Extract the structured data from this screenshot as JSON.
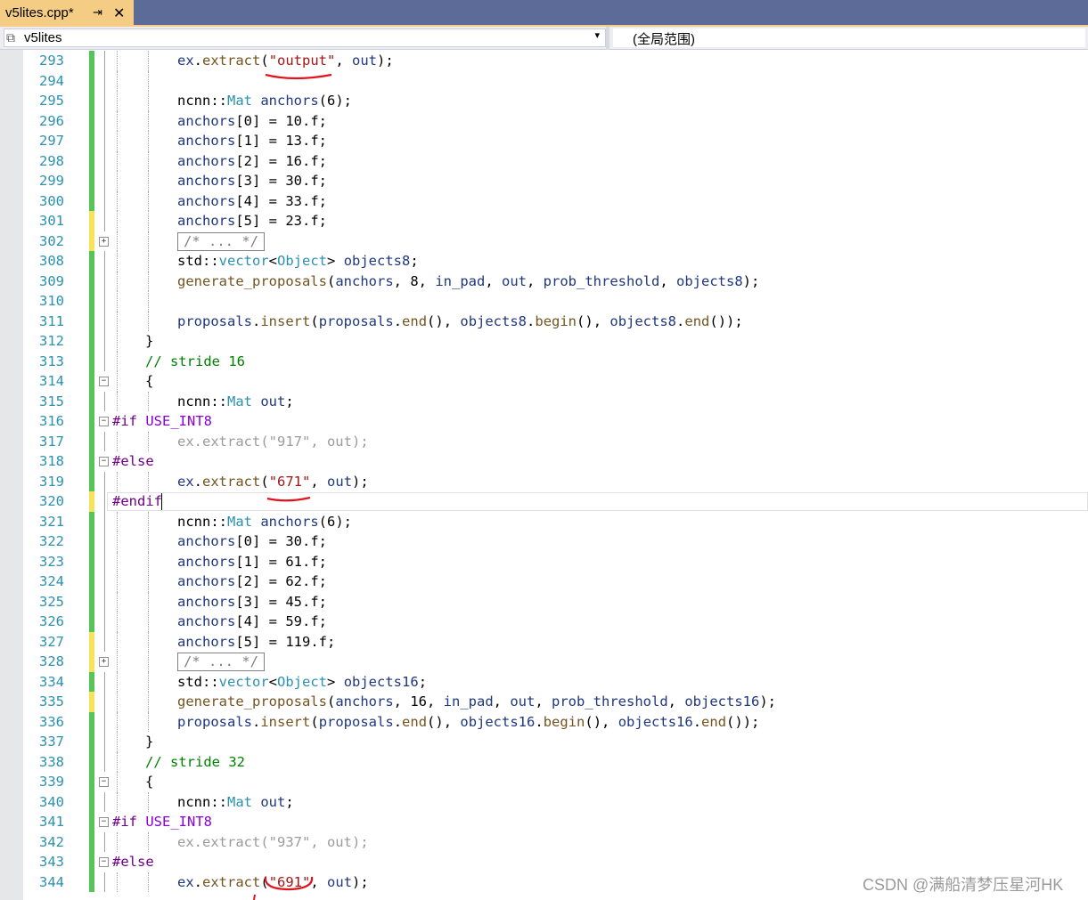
{
  "tab": {
    "title": "v5lites.cpp*",
    "pin_icon": "pin-icon",
    "close_icon": "close-icon"
  },
  "nav": {
    "project": "v5lites",
    "scope": "(全局范围)"
  },
  "watermark": "CSDN @满船清梦压星河HK",
  "colors": {
    "tab_bg": "#f5cc84",
    "tabbar_bg": "#5d6b99",
    "line_number": "#2b91af",
    "changed_saved": "#57c45a",
    "changed_unsaved": "#f5e35c"
  },
  "lines": [
    {
      "n": "293",
      "chg": "g",
      "indent": 2,
      "tokens": [
        [
          "id",
          "ex"
        ],
        [
          "",
          "."
        ],
        [
          "fn",
          "extract"
        ],
        [
          "",
          "("
        ],
        [
          "str",
          "\"output\""
        ],
        [
          "",
          ", "
        ],
        [
          "id",
          "out"
        ],
        [
          "",
          ");"
        ]
      ]
    },
    {
      "n": "294",
      "chg": "g",
      "indent": 0,
      "tokens": []
    },
    {
      "n": "295",
      "chg": "g",
      "indent": 2,
      "tokens": [
        [
          "",
          "ncnn::"
        ],
        [
          "ty",
          "Mat"
        ],
        [
          "",
          ""
        ],
        [
          "id",
          " anchors"
        ],
        [
          "",
          "("
        ],
        [
          "num",
          "6"
        ],
        [
          "",
          ");"
        ]
      ]
    },
    {
      "n": "296",
      "chg": "g",
      "indent": 2,
      "tokens": [
        [
          "id",
          "anchors"
        ],
        [
          "",
          "[0] = 10.f;"
        ]
      ]
    },
    {
      "n": "297",
      "chg": "g",
      "indent": 2,
      "tokens": [
        [
          "id",
          "anchors"
        ],
        [
          "",
          "[1] = 13.f;"
        ]
      ]
    },
    {
      "n": "298",
      "chg": "g",
      "indent": 2,
      "tokens": [
        [
          "id",
          "anchors"
        ],
        [
          "",
          "[2] = 16.f;"
        ]
      ]
    },
    {
      "n": "299",
      "chg": "g",
      "indent": 2,
      "tokens": [
        [
          "id",
          "anchors"
        ],
        [
          "",
          "[3] = 30.f;"
        ]
      ]
    },
    {
      "n": "300",
      "chg": "g",
      "indent": 2,
      "tokens": [
        [
          "id",
          "anchors"
        ],
        [
          "",
          "[4] = 33.f;"
        ]
      ]
    },
    {
      "n": "301",
      "chg": "y",
      "indent": 2,
      "tokens": [
        [
          "id",
          "anchors"
        ],
        [
          "",
          "[5] = 23.f;"
        ]
      ]
    },
    {
      "n": "302",
      "chg": "y",
      "indent": 2,
      "fold": "+",
      "collapsed": "/* ... */",
      "tokens": []
    },
    {
      "n": "308",
      "chg": "g",
      "indent": 2,
      "tokens": [
        [
          "",
          "std::"
        ],
        [
          "ty",
          "vector"
        ],
        [
          "",
          "<"
        ],
        [
          "ty",
          "Object"
        ],
        [
          "",
          "> "
        ],
        [
          "id",
          "objects8"
        ],
        [
          "",
          ";"
        ]
      ]
    },
    {
      "n": "309",
      "chg": "g",
      "indent": 2,
      "tokens": [
        [
          "fn",
          "generate_proposals"
        ],
        [
          "",
          "("
        ],
        [
          "id",
          "anchors"
        ],
        [
          "",
          ", 8, "
        ],
        [
          "id",
          "in_pad"
        ],
        [
          "",
          ", "
        ],
        [
          "id",
          "out"
        ],
        [
          "",
          ", "
        ],
        [
          "id",
          "prob_threshold"
        ],
        [
          "",
          ", "
        ],
        [
          "id",
          "objects8"
        ],
        [
          "",
          ");"
        ]
      ]
    },
    {
      "n": "310",
      "chg": "g",
      "indent": 0,
      "tokens": []
    },
    {
      "n": "311",
      "chg": "g",
      "indent": 2,
      "tokens": [
        [
          "id",
          "proposals"
        ],
        [
          "",
          "."
        ],
        [
          "fn",
          "insert"
        ],
        [
          "",
          "("
        ],
        [
          "id",
          "proposals"
        ],
        [
          "",
          "."
        ],
        [
          "fn",
          "end"
        ],
        [
          "",
          "(), "
        ],
        [
          "id",
          "objects8"
        ],
        [
          "",
          "."
        ],
        [
          "fn",
          "begin"
        ],
        [
          "",
          "(), "
        ],
        [
          "id",
          "objects8"
        ],
        [
          "",
          "."
        ],
        [
          "fn",
          "end"
        ],
        [
          "",
          "());"
        ]
      ]
    },
    {
      "n": "312",
      "chg": "g",
      "indent": 1,
      "tokens": [
        [
          "",
          "}"
        ]
      ]
    },
    {
      "n": "313",
      "chg": "g",
      "indent": 1,
      "tokens": [
        [
          "cm",
          "// stride 16"
        ]
      ]
    },
    {
      "n": "314",
      "chg": "g",
      "indent": 1,
      "fold": "-",
      "tokens": [
        [
          "",
          "{"
        ]
      ]
    },
    {
      "n": "315",
      "chg": "g",
      "indent": 2,
      "tokens": [
        [
          "",
          "ncnn::"
        ],
        [
          "ty",
          "Mat"
        ],
        [
          "id",
          " out"
        ],
        [
          "",
          ";"
        ]
      ]
    },
    {
      "n": "316",
      "chg": "g",
      "indent": 0,
      "fold": "-",
      "tokens": [
        [
          "",
          "#if "
        ],
        [
          "mac",
          "USE_INT8"
        ]
      ]
    },
    {
      "n": "317",
      "chg": "g",
      "indent": 2,
      "tokens": [
        [
          "inact",
          "ex.extract(\"917\", out);"
        ]
      ]
    },
    {
      "n": "318",
      "chg": "g",
      "indent": 0,
      "fold": "-",
      "tokens": [
        [
          "",
          "#else"
        ]
      ]
    },
    {
      "n": "319",
      "chg": "g",
      "indent": 2,
      "tokens": [
        [
          "id",
          "ex"
        ],
        [
          "",
          "."
        ],
        [
          "fn",
          "extract"
        ],
        [
          "",
          "("
        ],
        [
          "str",
          "\"671\""
        ],
        [
          "",
          ", "
        ],
        [
          "id",
          "out"
        ],
        [
          "",
          ");"
        ]
      ]
    },
    {
      "n": "320",
      "chg": "y",
      "indent": 0,
      "current": true,
      "tokens": [
        [
          "",
          "#endif"
        ]
      ]
    },
    {
      "n": "321",
      "chg": "g",
      "indent": 2,
      "tokens": [
        [
          "",
          "ncnn::"
        ],
        [
          "ty",
          "Mat"
        ],
        [
          "id",
          " anchors"
        ],
        [
          "",
          "("
        ],
        [
          "num",
          "6"
        ],
        [
          "",
          ");"
        ]
      ]
    },
    {
      "n": "322",
      "chg": "g",
      "indent": 2,
      "tokens": [
        [
          "id",
          "anchors"
        ],
        [
          "",
          "[0] = 30.f;"
        ]
      ]
    },
    {
      "n": "323",
      "chg": "g",
      "indent": 2,
      "tokens": [
        [
          "id",
          "anchors"
        ],
        [
          "",
          "[1] = 61.f;"
        ]
      ]
    },
    {
      "n": "324",
      "chg": "g",
      "indent": 2,
      "tokens": [
        [
          "id",
          "anchors"
        ],
        [
          "",
          "[2] = 62.f;"
        ]
      ]
    },
    {
      "n": "325",
      "chg": "g",
      "indent": 2,
      "tokens": [
        [
          "id",
          "anchors"
        ],
        [
          "",
          "[3] = 45.f;"
        ]
      ]
    },
    {
      "n": "326",
      "chg": "g",
      "indent": 2,
      "tokens": [
        [
          "id",
          "anchors"
        ],
        [
          "",
          "[4] = 59.f;"
        ]
      ]
    },
    {
      "n": "327",
      "chg": "y",
      "indent": 2,
      "tokens": [
        [
          "id",
          "anchors"
        ],
        [
          "",
          "[5] = 119.f;"
        ]
      ]
    },
    {
      "n": "328",
      "chg": "y",
      "indent": 2,
      "fold": "+",
      "collapsed": "/* ... */",
      "tokens": []
    },
    {
      "n": "334",
      "chg": "g",
      "indent": 2,
      "tokens": [
        [
          "",
          "std::"
        ],
        [
          "ty",
          "vector"
        ],
        [
          "",
          "<"
        ],
        [
          "ty",
          "Object"
        ],
        [
          "",
          "> "
        ],
        [
          "id",
          "objects16"
        ],
        [
          "",
          ";"
        ]
      ]
    },
    {
      "n": "335",
      "chg": "y",
      "indent": 2,
      "tokens": [
        [
          "fn",
          "generate_proposals"
        ],
        [
          "",
          "("
        ],
        [
          "id",
          "anchors"
        ],
        [
          "",
          ", 16, "
        ],
        [
          "id",
          "in_pad"
        ],
        [
          "",
          ", "
        ],
        [
          "id",
          "out"
        ],
        [
          "",
          ", "
        ],
        [
          "id",
          "prob_threshold"
        ],
        [
          "",
          ", "
        ],
        [
          "id",
          "objects16"
        ],
        [
          "",
          ");"
        ]
      ]
    },
    {
      "n": "336",
      "chg": "g",
      "indent": 2,
      "tokens": [
        [
          "id",
          "proposals"
        ],
        [
          "",
          "."
        ],
        [
          "fn",
          "insert"
        ],
        [
          "",
          "("
        ],
        [
          "id",
          "proposals"
        ],
        [
          "",
          "."
        ],
        [
          "fn",
          "end"
        ],
        [
          "",
          "(), "
        ],
        [
          "id",
          "objects16"
        ],
        [
          "",
          "."
        ],
        [
          "fn",
          "begin"
        ],
        [
          "",
          "(), "
        ],
        [
          "id",
          "objects16"
        ],
        [
          "",
          "."
        ],
        [
          "fn",
          "end"
        ],
        [
          "",
          "());"
        ]
      ]
    },
    {
      "n": "337",
      "chg": "g",
      "indent": 1,
      "tokens": [
        [
          "",
          "}"
        ]
      ]
    },
    {
      "n": "338",
      "chg": "g",
      "indent": 1,
      "tokens": [
        [
          "cm",
          "// stride 32"
        ]
      ]
    },
    {
      "n": "339",
      "chg": "g",
      "indent": 1,
      "fold": "-",
      "tokens": [
        [
          "",
          "{"
        ]
      ]
    },
    {
      "n": "340",
      "chg": "g",
      "indent": 2,
      "tokens": [
        [
          "",
          "ncnn::"
        ],
        [
          "ty",
          "Mat"
        ],
        [
          "id",
          " out"
        ],
        [
          "",
          ";"
        ]
      ]
    },
    {
      "n": "341",
      "chg": "g",
      "indent": 0,
      "fold": "-",
      "tokens": [
        [
          "",
          "#if "
        ],
        [
          "mac",
          "USE_INT8"
        ]
      ]
    },
    {
      "n": "342",
      "chg": "g",
      "indent": 2,
      "tokens": [
        [
          "inact",
          "ex.extract(\"937\", out);"
        ]
      ]
    },
    {
      "n": "343",
      "chg": "g",
      "indent": 0,
      "fold": "-",
      "tokens": [
        [
          "",
          "#else"
        ]
      ]
    },
    {
      "n": "344",
      "chg": "g",
      "indent": 2,
      "tokens": [
        [
          "id",
          "ex"
        ],
        [
          "",
          "."
        ],
        [
          "fn",
          "extract"
        ],
        [
          "",
          "("
        ],
        [
          "str",
          "\"691\""
        ],
        [
          "",
          ", "
        ],
        [
          "id",
          "out"
        ],
        [
          "",
          ");"
        ]
      ]
    }
  ]
}
